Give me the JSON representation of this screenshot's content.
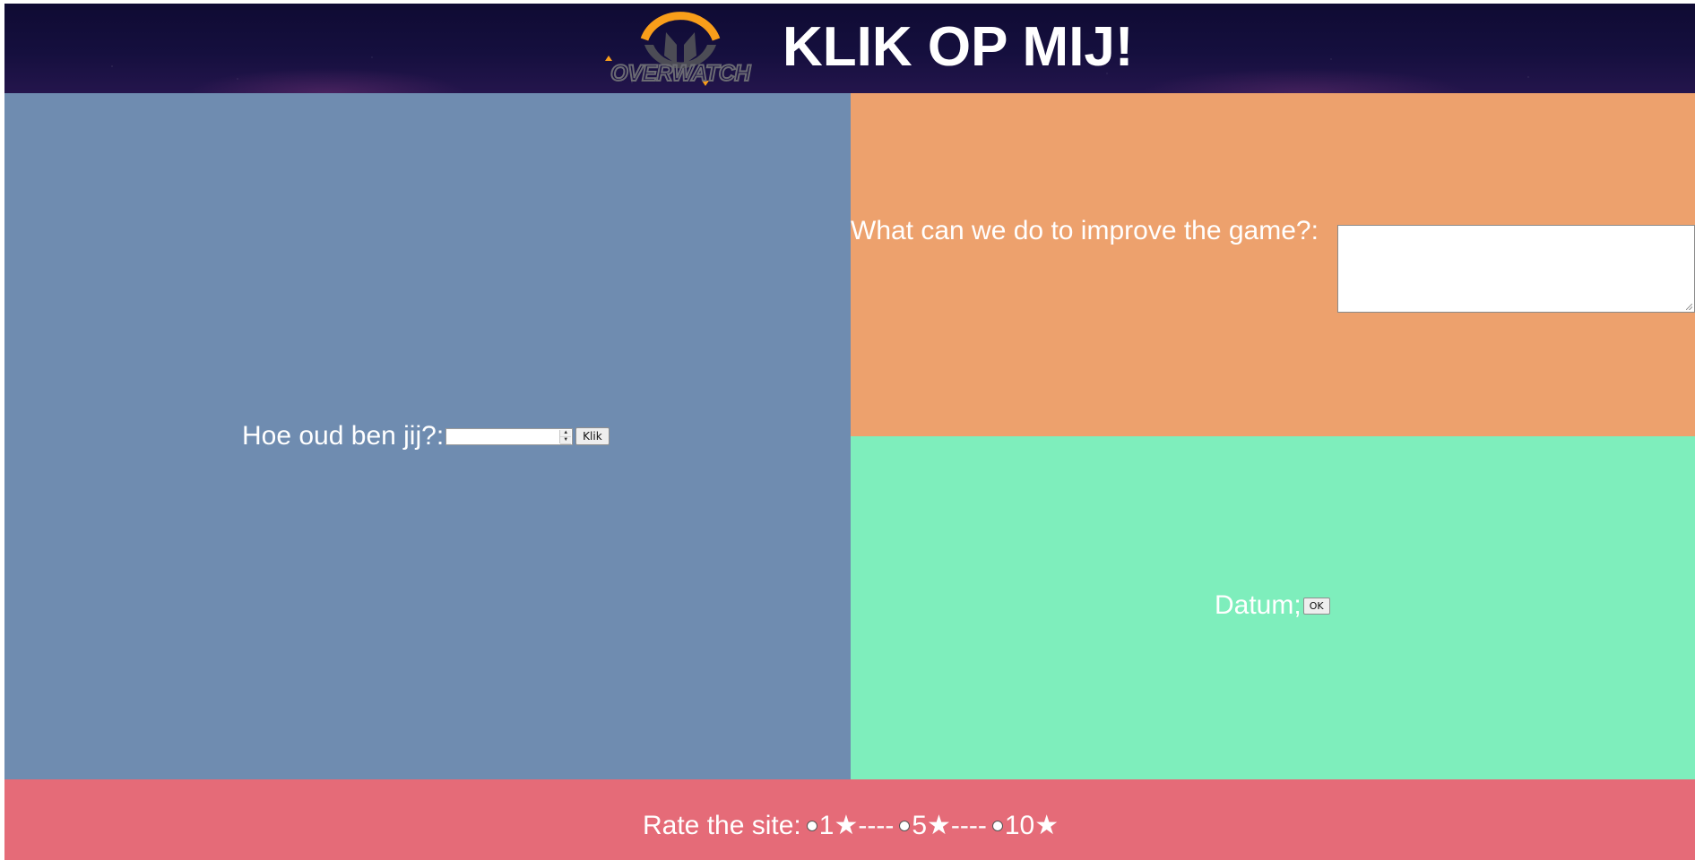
{
  "header": {
    "logo_text": "OVERWATCH",
    "title": "KLIK OP MIJ!"
  },
  "age_form": {
    "label": "Hoe oud ben jij?:",
    "input_value": "",
    "button_label": "Klik"
  },
  "improve_form": {
    "label": "What can we do to improve the game?:",
    "textarea_value": ""
  },
  "date_form": {
    "label": "Datum;",
    "button_label": "OK"
  },
  "rating": {
    "label": "Rate the site:",
    "options": [
      "1★----",
      "5★----",
      "10★"
    ],
    "selected": null
  },
  "colors": {
    "header_bg": "#150f3e",
    "left_panel": "#6f8cb0",
    "top_right_panel": "#eda16d",
    "bottom_right_panel": "#7eeebc",
    "footer_panel": "#e56b78",
    "logo_accent": "#f99e1a"
  }
}
